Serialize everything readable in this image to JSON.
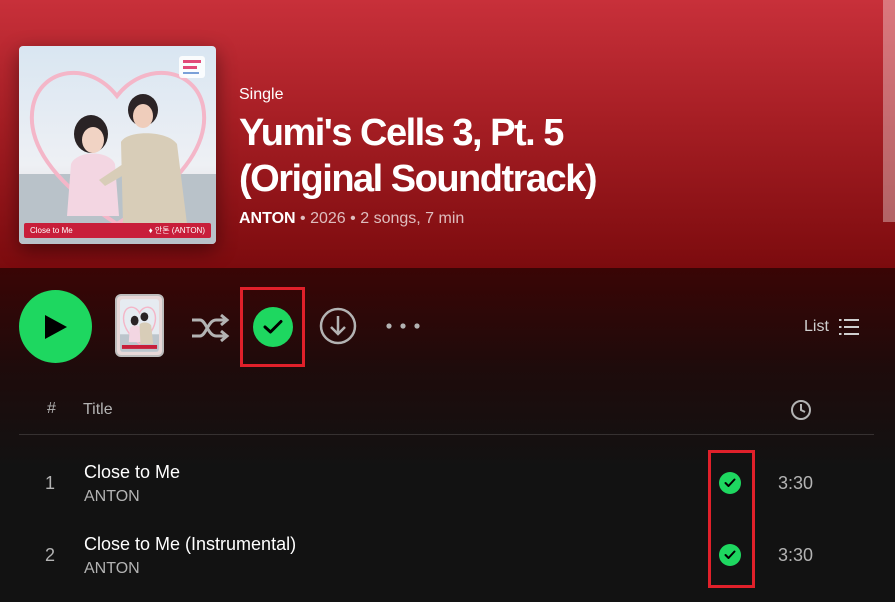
{
  "album": {
    "type_label": "Single",
    "title": "Yumi's Cells 3, Pt. 5 (Original Soundtrack)",
    "artist": "ANTON",
    "year": "2026",
    "summary": "2 songs, 7 min",
    "separator": "•",
    "cover_caption_left": "Close to Me",
    "cover_caption_right": "♦ 안톤 (ANTON)"
  },
  "controls": {
    "play_icon": "play-icon",
    "shuffle_icon": "shuffle-icon",
    "saved_icon": "check-circle-icon",
    "download_icon": "download-icon",
    "more_icon": "more-icon",
    "view_label": "List",
    "view_icon": "list-icon"
  },
  "table": {
    "num_header": "#",
    "title_header": "Title",
    "duration_icon": "clock-icon"
  },
  "tracks": [
    {
      "number": "1",
      "name": "Close to Me",
      "artist": "ANTON",
      "duration": "3:30",
      "saved": true
    },
    {
      "number": "2",
      "name": "Close to Me (Instrumental)",
      "artist": "ANTON",
      "duration": "3:30",
      "saved": true
    }
  ],
  "colors": {
    "accent": "#1ed760",
    "header_top": "#c8303a",
    "header_bottom": "#7c0b0e",
    "highlight_box": "#e0202a",
    "background": "#121212"
  }
}
